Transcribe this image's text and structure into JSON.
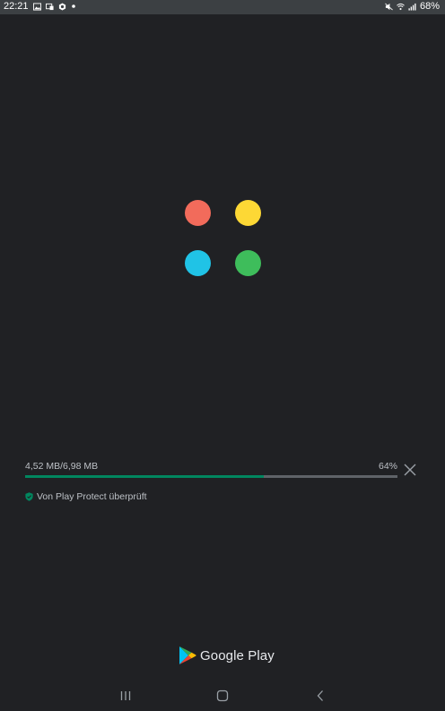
{
  "status_bar": {
    "time": "22:21",
    "left_icons": [
      "gallery-icon",
      "cast-icon",
      "settings-icon",
      "dot-icon"
    ],
    "right_icons": [
      "mute-icon",
      "wifi-icon",
      "signal-icon"
    ],
    "battery": "68%"
  },
  "logo": {
    "colors": [
      "#f26b5b",
      "#fdd835",
      "#20c3e6",
      "#3ebd5b"
    ]
  },
  "download": {
    "size_text": "4,52 MB/6,98 MB",
    "percent_text": "64%",
    "progress": 0.64,
    "bar_color": "#01875f",
    "track_color": "#5f6368"
  },
  "protect": {
    "text": "Von Play Protect überprüft",
    "icon": "shield-check-icon",
    "color": "#01875f"
  },
  "footer": {
    "brand": "Google Play"
  },
  "nav_bar": {
    "buttons": [
      "recents-icon",
      "home-icon",
      "back-icon"
    ]
  }
}
